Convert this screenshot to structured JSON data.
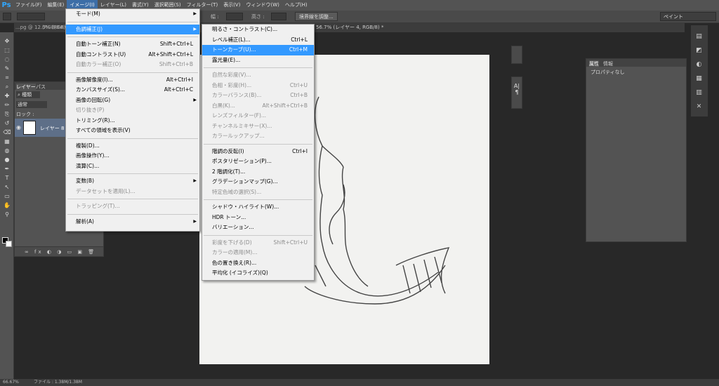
{
  "app": {
    "logo": "Ps"
  },
  "menubar": [
    "ファイル(F)",
    "編集(E)",
    "イメージ(I)",
    "レイヤー(L)",
    "書式(Y)",
    "選択範囲(S)",
    "フィルター(T)",
    "表示(V)",
    "ウィンドウ(W)",
    "ヘルプ(H)"
  ],
  "menubar_active_index": 2,
  "options": {
    "width_label": "幅 :",
    "height_label": "高さ :",
    "button": "境界線を調整...",
    "workspace": "ペイント"
  },
  "doctabs": [
    "...pg @ 12.5% (RGB/8#)",
    "(RGB/8#)",
    "56.7% (レイヤー 4, RGB/8) *"
  ],
  "tools": [
    "move-icon",
    "marquee-icon",
    "lasso-icon",
    "quick-select-icon",
    "crop-icon",
    "eyedropper-icon",
    "healing-icon",
    "brush-icon",
    "stamp-icon",
    "history-brush-icon",
    "eraser-icon",
    "gradient-icon",
    "blur-icon",
    "dodge-icon",
    "pen-icon",
    "type-icon",
    "path-select-icon",
    "shape-icon",
    "hand-icon",
    "zoom-icon"
  ],
  "layers": {
    "tabs": [
      "レイヤー",
      "パス"
    ],
    "kind": "種類",
    "blend": "通常",
    "opacity_short": "不透",
    "lock": "ロック :",
    "layer_name": "レイヤー 8"
  },
  "properties": {
    "tabs": [
      "属性",
      "情報"
    ],
    "title": "プロパティなし"
  },
  "status": {
    "zoom": "66.67%",
    "file": "ファイル : 1.38M/1.38M"
  },
  "image_menu": [
    {
      "label": "モード(M)",
      "submenu": true
    },
    {
      "sep": true
    },
    {
      "label": "色調補正(J)",
      "submenu": true,
      "highlight": true
    },
    {
      "sep": true
    },
    {
      "label": "自動トーン補正(N)",
      "shortcut": "Shift+Ctrl+L"
    },
    {
      "label": "自動コントラスト(U)",
      "shortcut": "Alt+Shift+Ctrl+L"
    },
    {
      "label": "自動カラー補正(O)",
      "shortcut": "Shift+Ctrl+B",
      "disabled": true
    },
    {
      "sep": true
    },
    {
      "label": "画像解像度(I)...",
      "shortcut": "Alt+Ctrl+I"
    },
    {
      "label": "カンバスサイズ(S)...",
      "shortcut": "Alt+Ctrl+C"
    },
    {
      "label": "画像の回転(G)",
      "submenu": true
    },
    {
      "label": "切り抜き(P)",
      "disabled": true
    },
    {
      "label": "トリミング(R)..."
    },
    {
      "label": "すべての領域を表示(V)"
    },
    {
      "sep": true
    },
    {
      "label": "複製(D)..."
    },
    {
      "label": "画像操作(Y)..."
    },
    {
      "label": "演算(C)..."
    },
    {
      "sep": true
    },
    {
      "label": "変数(B)",
      "submenu": true
    },
    {
      "label": "データセットを適用(L)...",
      "disabled": true
    },
    {
      "sep": true
    },
    {
      "label": "トラッピング(T)...",
      "disabled": true
    },
    {
      "sep": true
    },
    {
      "label": "解析(A)",
      "submenu": true
    }
  ],
  "adjust_menu": [
    {
      "label": "明るさ・コントラスト(C)..."
    },
    {
      "label": "レベル補正(L)...",
      "shortcut": "Ctrl+L"
    },
    {
      "label": "トーンカーブ(U)...",
      "shortcut": "Ctrl+M",
      "highlight": true
    },
    {
      "label": "露光量(E)..."
    },
    {
      "sep": true
    },
    {
      "label": "自然な彩度(V)...",
      "disabled": true
    },
    {
      "label": "色相・彩度(H)...",
      "shortcut": "Ctrl+U",
      "disabled": true
    },
    {
      "label": "カラーバランス(B)...",
      "shortcut": "Ctrl+B",
      "disabled": true
    },
    {
      "label": "白黒(K)...",
      "shortcut": "Alt+Shift+Ctrl+B",
      "disabled": true
    },
    {
      "label": "レンズフィルター(F)...",
      "disabled": true
    },
    {
      "label": "チャンネルミキサー(X)...",
      "disabled": true
    },
    {
      "label": "カラールックアップ...",
      "disabled": true
    },
    {
      "sep": true
    },
    {
      "label": "階調の反転(I)",
      "shortcut": "Ctrl+I"
    },
    {
      "label": "ポスタリゼーション(P)..."
    },
    {
      "label": "2 階調化(T)..."
    },
    {
      "label": "グラデーションマップ(G)..."
    },
    {
      "label": "特定色域の選択(S)...",
      "disabled": true
    },
    {
      "sep": true
    },
    {
      "label": "シャドウ・ハイライト(W)..."
    },
    {
      "label": "HDR トーン..."
    },
    {
      "label": "バリエーション..."
    },
    {
      "sep": true
    },
    {
      "label": "彩度を下げる(D)",
      "shortcut": "Shift+Ctrl+U",
      "disabled": true
    },
    {
      "label": "カラーの適用(M)...",
      "disabled": true
    },
    {
      "label": "色の置き換え(R)..."
    },
    {
      "label": "平均化 (イコライズ)(Q)"
    }
  ]
}
